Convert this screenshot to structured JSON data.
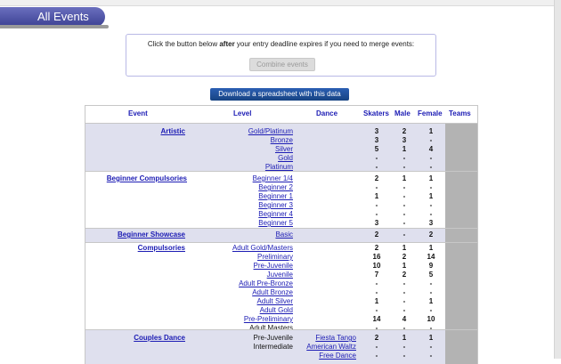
{
  "header": {
    "title": "All Events"
  },
  "merge": {
    "text_before": "Click the button below ",
    "text_bold": "after",
    "text_after": " your entry deadline expires if you need to merge events:",
    "combine_label": "Combine events"
  },
  "download_label": "Download a spreadsheet with this data",
  "table": {
    "headers": {
      "event": "Event",
      "level": "Level",
      "dance": "Dance",
      "skaters": "Skaters",
      "male": "Male",
      "female": "Female",
      "teams": "Teams"
    },
    "artistic": {
      "event": "Artistic",
      "levels": [
        "Gold/Platinum",
        "Bronze",
        "Silver",
        "Gold",
        "Platinum"
      ],
      "skaters": [
        "3",
        "3",
        "5",
        "-",
        "-"
      ],
      "male": [
        "2",
        "3",
        "1",
        "-",
        "-"
      ],
      "female": [
        "1",
        "-",
        "4",
        "-",
        "-"
      ]
    },
    "beginner_compulsories": {
      "event": "Beginner Compulsories",
      "levels": [
        "Beginner 1/4",
        "Beginner 2",
        "Beginner 1",
        "Beginner 3",
        "Beginner 4",
        "Beginner 5"
      ],
      "skaters": [
        "2",
        "-",
        "1",
        "-",
        "-",
        "3"
      ],
      "male": [
        "1",
        "-",
        "-",
        "-",
        "-",
        "-"
      ],
      "female": [
        "1",
        "-",
        "1",
        "-",
        "-",
        "3"
      ]
    },
    "beginner_showcase": {
      "event": "Beginner Showcase",
      "levels": [
        "Basic"
      ],
      "skaters": [
        "2"
      ],
      "male": [
        "-"
      ],
      "female": [
        "2"
      ]
    },
    "compulsories": {
      "event": "Compulsories",
      "levels": [
        "Adult Gold/Masters",
        "Preliminary",
        "Pre-Juvenile",
        "Juvenile",
        "Adult Pre-Bronze",
        "Adult Bronze",
        "Adult Silver",
        "Adult Gold",
        "Pre-Preliminary",
        "Adult Masters"
      ],
      "skaters": [
        "2",
        "16",
        "10",
        "7",
        "-",
        "-",
        "1",
        "-",
        "14",
        "-"
      ],
      "male": [
        "1",
        "2",
        "1",
        "2",
        "-",
        "-",
        "-",
        "-",
        "4",
        "-"
      ],
      "female": [
        "1",
        "14",
        "9",
        "5",
        "-",
        "-",
        "1",
        "-",
        "10",
        "-"
      ]
    },
    "couples_dance": {
      "event": "Couples Dance",
      "levels": [
        "Pre-Juvenile",
        "Intermediate",
        ""
      ],
      "dances": [
        "Fiesta Tango",
        "American Waltz",
        "Free Dance"
      ],
      "skaters": [
        "2",
        "-",
        "-"
      ],
      "male": [
        "1",
        "-",
        "-"
      ],
      "female": [
        "1",
        "-",
        "-"
      ]
    }
  }
}
